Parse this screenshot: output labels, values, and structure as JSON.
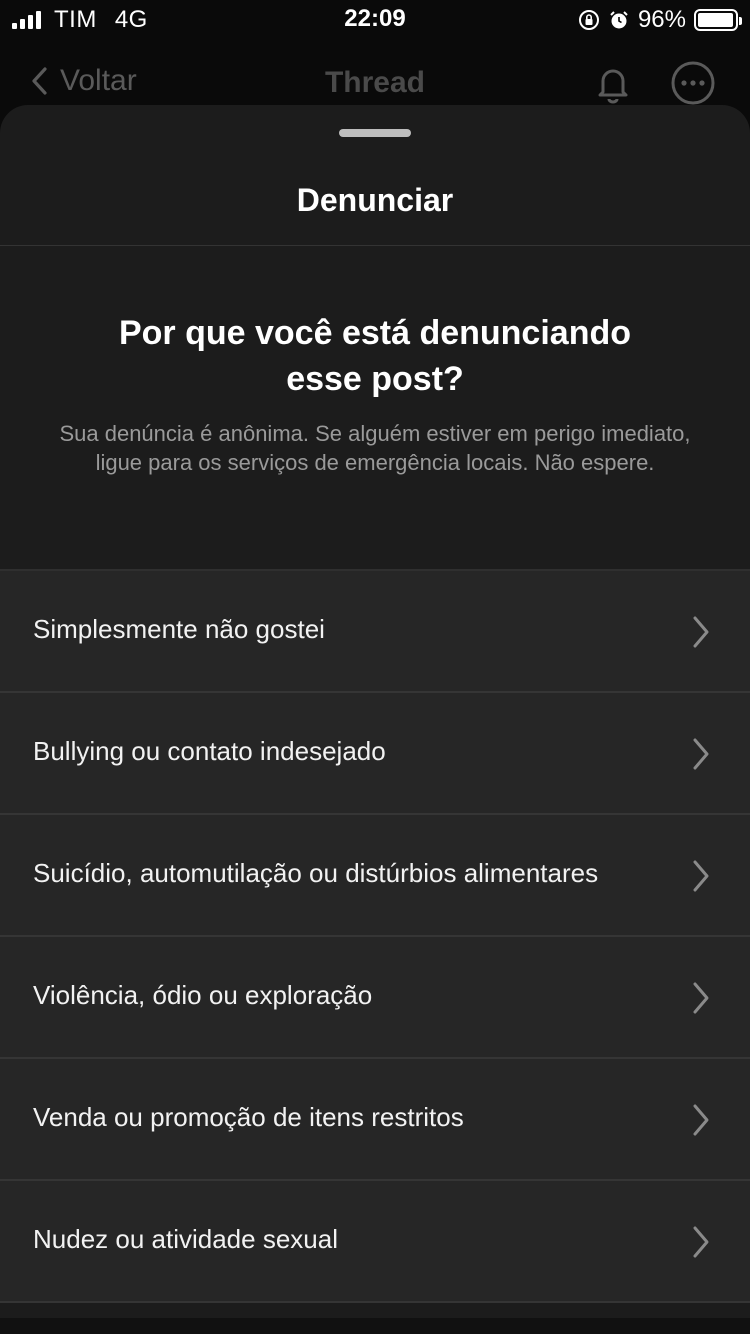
{
  "status_bar": {
    "carrier": "TIM",
    "network": "4G",
    "time": "22:09",
    "battery_percent": "96%",
    "battery_level": 0.96,
    "icons": [
      "signal-icon",
      "orientation-lock-icon",
      "alarm-icon",
      "battery-icon"
    ]
  },
  "nav": {
    "back_label": "Voltar",
    "title": "Thread",
    "icons": [
      "chevron-left-icon",
      "bell-icon",
      "more-icon"
    ]
  },
  "sheet": {
    "title": "Denunciar",
    "question": "Por que você está denunciando esse post?",
    "subtitle": "Sua denúncia é anônima. Se alguém estiver em perigo imediato, ligue para os serviços de emergência locais. Não espere.",
    "reasons": [
      {
        "label": "Simplesmente não gostei"
      },
      {
        "label": "Bullying ou contato indesejado"
      },
      {
        "label": "Suicídio, automutilação ou distúrbios alimentares"
      },
      {
        "label": "Violência, ódio ou exploração"
      },
      {
        "label": "Venda ou promoção de itens restritos"
      },
      {
        "label": "Nudez ou atividade sexual"
      }
    ]
  },
  "colors": {
    "background": "#0a0a0a",
    "sheet": "#1c1c1c",
    "row": "#262626",
    "text": "#ffffff",
    "muted": "#9a9a9a"
  }
}
